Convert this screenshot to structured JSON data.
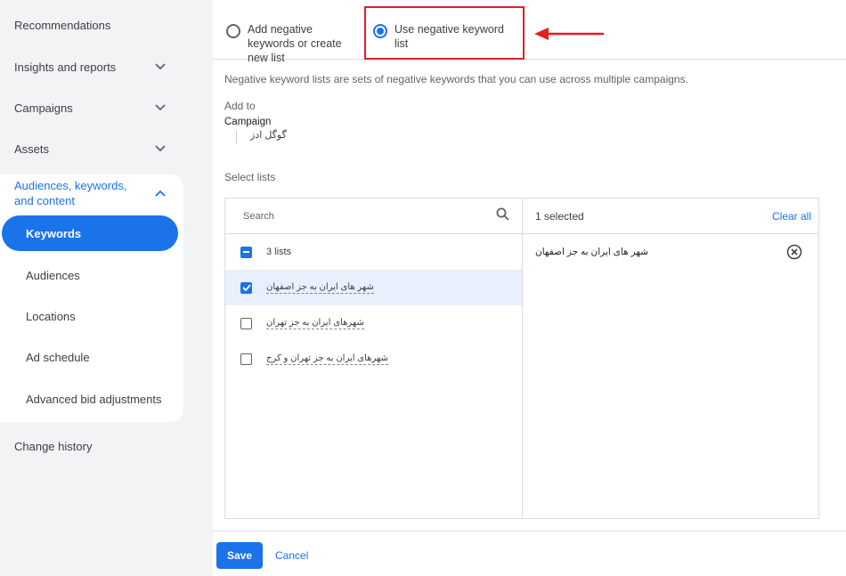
{
  "sidebar": {
    "items": [
      {
        "label": "Recommendations"
      },
      {
        "label": "Insights and reports"
      },
      {
        "label": "Campaigns"
      },
      {
        "label": "Assets"
      }
    ],
    "group": {
      "label": "Audiences, keywords, and content",
      "items": [
        {
          "label": "Keywords"
        },
        {
          "label": "Audiences"
        },
        {
          "label": "Locations"
        },
        {
          "label": "Ad schedule"
        },
        {
          "label": "Advanced bid adjustments"
        }
      ]
    },
    "change_history": "Change history"
  },
  "options": {
    "add_new": "Add negative keywords or create new list",
    "use_list": "Use negative keyword list"
  },
  "description": "Negative keyword lists are sets of negative keywords that you can use across multiple campaigns.",
  "add_to": {
    "label": "Add to",
    "campaign_label": "Campaign",
    "campaign_name": "گوگل ادز"
  },
  "select_lists": {
    "label": "Select lists",
    "search_placeholder": "Search",
    "all_label": "3 lists",
    "lists": [
      {
        "name": "شهر های ایران به جز اصفهان",
        "checked": true
      },
      {
        "name": "شهرهای ایران به جز تهران",
        "checked": false
      },
      {
        "name": "شهرهای ایران به جز تهران و کرج",
        "checked": false
      }
    ],
    "selected_count": "1 selected",
    "clear_all": "Clear all",
    "selected_items": [
      "شهر های ایران به جز اصفهان"
    ]
  },
  "footer": {
    "save": "Save",
    "cancel": "Cancel"
  },
  "colors": {
    "accent": "#1a73e8",
    "annotation": "#e31e24"
  }
}
